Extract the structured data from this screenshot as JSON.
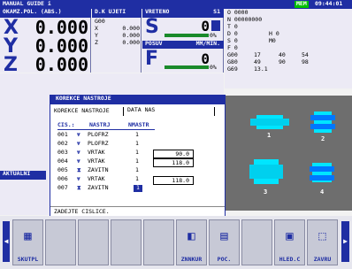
{
  "header": {
    "title": "MANUAL GUIDE i",
    "status": "MEM",
    "clock": "09:44:01"
  },
  "position": {
    "title": "OKAMZ.POL. (ABS.)",
    "axes": [
      {
        "name": "X",
        "value": "0.000"
      },
      {
        "name": "Y",
        "value": "0.000"
      },
      {
        "name": "Z",
        "value": "0.000"
      }
    ]
  },
  "dkuzeti": {
    "title": "D.K UJETI",
    "code": "G00",
    "rows": [
      {
        "axis": "X",
        "value": "0.000"
      },
      {
        "axis": "Y",
        "value": "0.000"
      },
      {
        "axis": "Z",
        "value": "0.000"
      }
    ]
  },
  "spindle": {
    "title": "VRETENO",
    "slot": "S1",
    "s_label": "S",
    "s_value": "0",
    "s_percent": "0%",
    "posuv_title": "POSUV",
    "posuv_unit": "MM/MIN.",
    "f_label": "F",
    "f_value": "0",
    "f_percent": "0%"
  },
  "program": {
    "o": "O 0000",
    "n": "N 00000000",
    "t": "T 0",
    "d": "D 0",
    "h": "H 0",
    "s": "S 0",
    "m": "M0",
    "f": "F 0",
    "g_rows": [
      [
        "G00",
        "17",
        "40",
        "54"
      ],
      [
        "G80",
        "49",
        "90",
        "98"
      ],
      [
        "G69",
        "13.1",
        "",
        ""
      ]
    ]
  },
  "dialog": {
    "title": "KOREKCE NASTROJE",
    "tab_left": "KOREKCE NASTROJE",
    "tab_right": "DATA NAS",
    "columns": [
      "CIS.:",
      "NASTRJ",
      "NMASTR"
    ],
    "rows": [
      {
        "num": "001",
        "icon": "drill",
        "name": "PLOFRZ",
        "n": "1",
        "val": ""
      },
      {
        "num": "002",
        "icon": "drill",
        "name": "PLOFRZ",
        "n": "1",
        "val": ""
      },
      {
        "num": "003",
        "icon": "drill",
        "name": "VRTAK",
        "n": "1",
        "val": "90.0"
      },
      {
        "num": "004",
        "icon": "drill",
        "name": "VRTAK",
        "n": "1",
        "val": "118.0"
      },
      {
        "num": "005",
        "icon": "tap",
        "name": "ZAVITN",
        "n": "1",
        "val": ""
      },
      {
        "num": "006",
        "icon": "drill",
        "name": "VRTAK",
        "n": "1",
        "val": "118.0"
      },
      {
        "num": "007",
        "icon": "tap",
        "name": "ZAVITN",
        "n": "1",
        "val": ""
      }
    ],
    "prompt": "ZADEJTE CISLICE."
  },
  "side_label": "AKTUALNI",
  "preview_labels": [
    "1",
    "2",
    "3",
    "4"
  ],
  "softkeys": [
    {
      "label": "SKUTPL"
    },
    {
      "label": ""
    },
    {
      "label": ""
    },
    {
      "label": ""
    },
    {
      "label": ""
    },
    {
      "label": "ZNNKUR"
    },
    {
      "label": "POC."
    },
    {
      "label": ""
    },
    {
      "label": "HLED.C"
    },
    {
      "label": "ZAVRU"
    }
  ]
}
